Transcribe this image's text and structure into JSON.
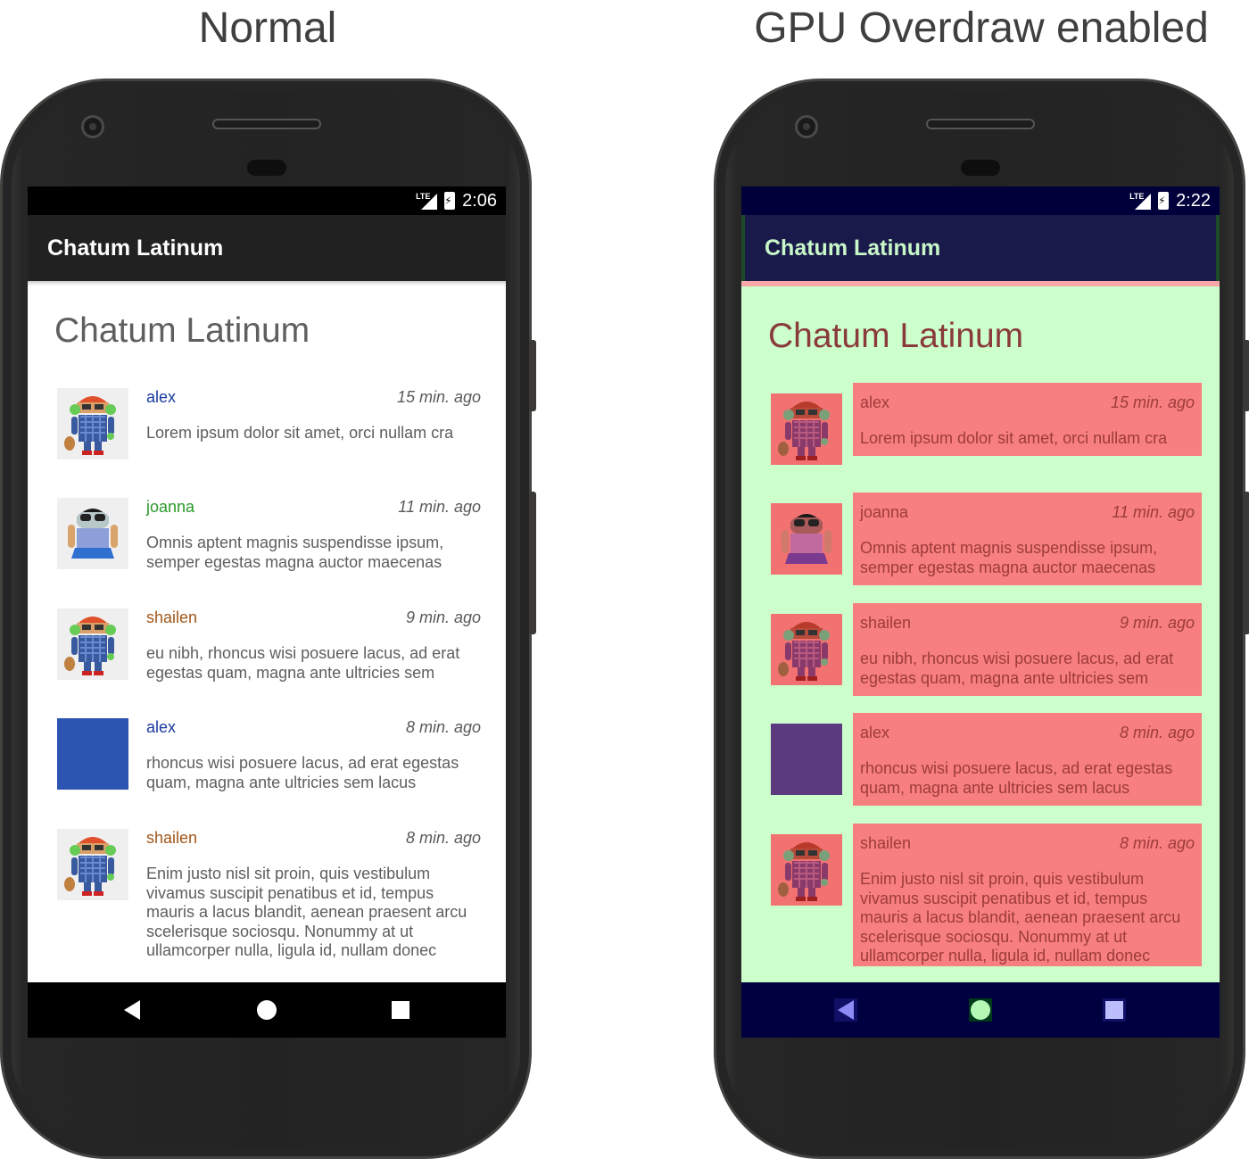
{
  "captions": {
    "normal": "Normal",
    "overdraw": "GPU Overdraw enabled"
  },
  "phones": [
    {
      "status_time": "2:06",
      "status_network": "LTE",
      "toolbar_title": "Chatum Latinum",
      "page_title": "Chatum Latinum",
      "messages": [
        {
          "name": "alex",
          "time": "15 min. ago",
          "text": "Lorem ipsum dolor sit amet, orci nullam cra",
          "name_color": "#1a3aa0",
          "avatar": "android-ukulele-icon"
        },
        {
          "name": "joanna",
          "time": "11 min. ago",
          "text": "Omnis aptent magnis suspendisse ipsum, semper egestas magna auctor maecenas",
          "name_color": "#2a9a2a",
          "avatar": "android-girl-icon"
        },
        {
          "name": "shailen",
          "time": "9 min. ago",
          "text": "eu nibh, rhoncus wisi posuere lacus, ad erat egestas quam, magna ante ultricies sem",
          "name_color": "#a0561a",
          "avatar": "android-ukulele-icon"
        },
        {
          "name": "alex",
          "time": "8 min. ago",
          "text": "rhoncus wisi posuere lacus, ad erat egestas quam, magna ante ultricies sem lacus",
          "name_color": "#1a3aa0",
          "avatar": "blue-square-icon"
        },
        {
          "name": "shailen",
          "time": "8 min. ago",
          "text": "Enim justo nisl sit proin, quis vestibulum vivamus suscipit penatibus et id, tempus mauris a lacus blandit, aenean praesent arcu scelerisque sociosqu. Nonummy at ut ullamcorper nulla, ligula id, nullam donec",
          "name_color": "#a0561a",
          "avatar": "android-ukulele-icon"
        }
      ]
    },
    {
      "status_time": "2:22",
      "status_network": "LTE",
      "toolbar_title": "Chatum Latinum",
      "page_title": "Chatum Latinum",
      "messages": [
        {
          "name": "alex",
          "time": "15 min. ago",
          "text": "Lorem ipsum dolor sit amet, orci nullam cra",
          "avatar": "android-ukulele-icon"
        },
        {
          "name": "joanna",
          "time": "11 min. ago",
          "text": "Omnis aptent magnis suspendisse ipsum, semper egestas magna auctor maecenas",
          "avatar": "android-girl-icon"
        },
        {
          "name": "shailen",
          "time": "9 min. ago",
          "text": "eu nibh, rhoncus wisi posuere lacus, ad erat egestas quam, magna ante ultricies sem",
          "avatar": "android-ukulele-icon"
        },
        {
          "name": "alex",
          "time": "8 min. ago",
          "text": "rhoncus wisi posuere lacus, ad erat egestas quam, magna ante ultricies sem lacus",
          "avatar": "blue-square-icon"
        },
        {
          "name": "shailen",
          "time": "8 min. ago",
          "text": "Enim justo nisl sit proin, quis vestibulum vivamus suscipit penatibus et id, tempus mauris a lacus blandit, aenean praesent arcu scelerisque sociosqu. Nonummy at ut ullamcorper nulla, ligula id, nullam donec",
          "avatar": "android-ukulele-icon"
        }
      ]
    }
  ],
  "nav": {
    "back_icon": "back-triangle-icon",
    "home_icon": "home-circle-icon",
    "recents_icon": "recents-square-icon"
  }
}
